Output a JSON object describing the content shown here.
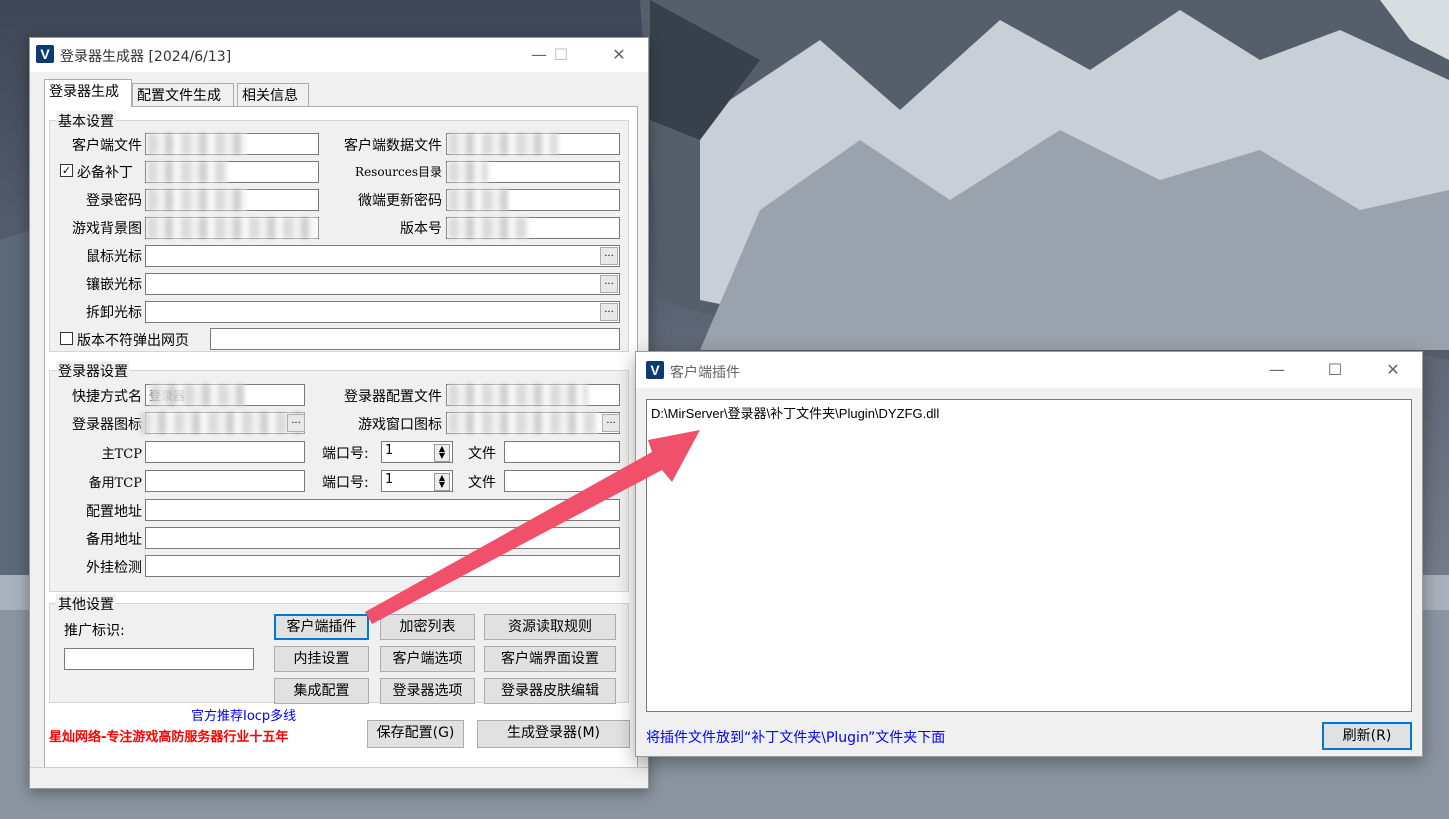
{
  "main_window": {
    "title": "登录器生成器 [2024/6/13]",
    "tabs": [
      "登录器生成",
      "配置文件生成",
      "相关信息"
    ],
    "basic": {
      "group_title": "基本设置",
      "client_file_label": "客户端文件",
      "client_data_file_label": "客户端数据文件",
      "required_patch_label": "必备补丁",
      "resources_dir_label": "Resources目录",
      "login_password_label": "登录密码",
      "micro_update_password_label": "微端更新密码",
      "game_bg_label": "游戏背景图",
      "version_label": "版本号",
      "mouse_cursor_label": "鼠标光标",
      "inlay_cursor_label": "镶嵌光标",
      "remove_cursor_label": "拆卸光标",
      "version_mismatch_label": "版本不符弹出网页",
      "browse_btn": "...",
      "checkmark": "✓"
    },
    "launcher": {
      "group_title": "登录器设置",
      "shortcut_label": "快捷方式名",
      "shortcut_value": "登录器",
      "launcher_config_label": "登录器配置文件",
      "launcher_icon_label": "登录器图标",
      "game_window_icon_label": "游戏窗口图标",
      "main_tcp_label": "主TCP",
      "backup_tcp_label": "备用TCP",
      "port_label": "端口号:",
      "port_value_1": "1",
      "port_value_2": "1",
      "file_label": "文件",
      "config_addr_label": "配置地址",
      "backup_addr_label": "备用地址",
      "plugin_check_label": "外挂检测"
    },
    "other": {
      "group_title": "其他设置",
      "promo_label": "推广标识:",
      "buttons": [
        [
          "客户端插件",
          "加密列表",
          "资源读取规则"
        ],
        [
          "内挂设置",
          "客户端选项",
          "客户端界面设置"
        ],
        [
          "集成配置",
          "登录器选项",
          "登录器皮肤编辑"
        ]
      ]
    },
    "recommend_text": "官方推荐Iocp多线",
    "brand_text": "星灿网络-专注游戏高防服务器行业十五年",
    "save_btn": "保存配置(G)",
    "generate_btn": "生成登录器(M)"
  },
  "plugin_window": {
    "title": "客户端插件",
    "list_items": [
      "D:\\MirServer\\登录器\\补丁文件夹\\Plugin\\DYZFG.dll"
    ],
    "hint": "将插件文件放到“补丁文件夹\\Plugin”文件夹下面",
    "refresh_btn": "刷新(R)"
  },
  "window_controls": {
    "minimize": "—",
    "maximize": "☐",
    "close": "✕"
  },
  "app_icon_letter": "V",
  "colors": {
    "accent_blue": "#0078d7",
    "brand_red": "#ff0000",
    "recommend_blue": "#0000ff",
    "arrow": "#f0506a"
  }
}
